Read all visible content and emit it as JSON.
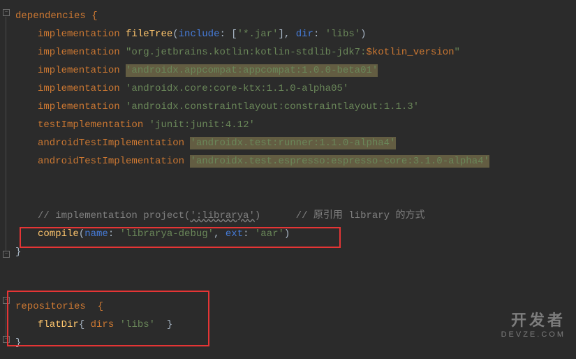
{
  "code": {
    "deps_open": "dependencies {",
    "l1_kw": "implementation ",
    "l1_fn": "fileTree",
    "l1_p1": "include",
    "l1_s1": "'*.jar'",
    "l1_p2": "dir",
    "l1_s2": "'libs'",
    "l2_kw": "implementation ",
    "l2_s1": "\"org.jetbrains.kotlin:kotlin-stdlib-jdk7:",
    "l2_var": "$kotlin_version",
    "l2_s2": "\"",
    "l3_kw": "implementation ",
    "l3_s": "'androidx.appcompat:appcompat:1.0.0-beta01'",
    "l4_kw": "implementation ",
    "l4_s": "'androidx.core:core-ktx:1.1.0-alpha05'",
    "l5_kw": "implementation ",
    "l5_s": "'androidx.constraintlayout:constraintlayout:1.1.3'",
    "l6_kw": "testImplementation ",
    "l6_s": "'junit:junit:4.12'",
    "l7_kw": "androidTestImplementation ",
    "l7_s": "'androidx.test:runner:1.1.0-alpha4'",
    "l8_kw": "androidTestImplementation ",
    "l8_s": "'androidx.test.espresso:espresso-core:3.1.0-alpha4'",
    "l10_c1": "// implementation project(",
    "l10_c2": "':librarya'",
    "l10_c3": ")      // 原引用 library 的方式",
    "l11_fn": "compile",
    "l11_p1": "name",
    "l11_s1": "'librarya-debug'",
    "l11_p2": "ext",
    "l11_s2": "'aar'",
    "close_brace": "}",
    "repos_open": "repositories  {",
    "repos_body_fn": "flatDir",
    "repos_body_kw": "dirs ",
    "repos_body_s": "'libs'"
  },
  "watermark": {
    "cn": "开发者",
    "en": "DEVZE.COM"
  }
}
